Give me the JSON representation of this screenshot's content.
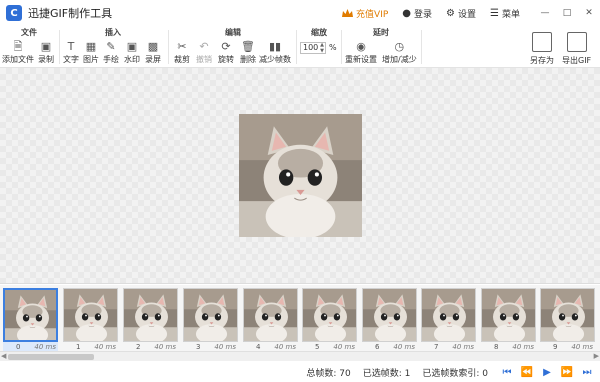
{
  "titlebar": {
    "app_title": "迅捷GIF制作工具",
    "vip_label": "充值VIP",
    "login_label": "登录",
    "settings_label": "设置",
    "menu_label": "菜单"
  },
  "ribbon": {
    "file": {
      "title": "文件",
      "add_file": "添加文件",
      "record": "录制"
    },
    "insert": {
      "title": "插入",
      "text": "文字",
      "image": "图片",
      "draw": "手绘",
      "watermark": "水印",
      "screen_record": "录屏"
    },
    "edit": {
      "title": "编辑",
      "crop": "裁剪",
      "undo": "撤销",
      "rotate": "旋转",
      "delete": "删除",
      "reduce_frames": "减少帧数"
    },
    "zoom": {
      "title": "缩放",
      "value": "100",
      "unit": "%"
    },
    "delay": {
      "title": "延时",
      "reset": "重新设置",
      "increase_decrease": "增加/减少"
    },
    "save_as": "另存为",
    "export_gif": "导出GIF"
  },
  "filmstrip": {
    "frames": [
      {
        "index": "0",
        "duration": "40 ms"
      },
      {
        "index": "1",
        "duration": "40 ms"
      },
      {
        "index": "2",
        "duration": "40 ms"
      },
      {
        "index": "3",
        "duration": "40 ms"
      },
      {
        "index": "4",
        "duration": "40 ms"
      },
      {
        "index": "5",
        "duration": "40 ms"
      },
      {
        "index": "6",
        "duration": "40 ms"
      },
      {
        "index": "7",
        "duration": "40 ms"
      },
      {
        "index": "8",
        "duration": "40 ms"
      },
      {
        "index": "9",
        "duration": "40 ms"
      }
    ],
    "selected_index": 0
  },
  "status": {
    "total_frames": "总帧数: 70",
    "selected_frames": "已选帧数: 1",
    "selected_index": "已选帧数索引: 0"
  },
  "colors": {
    "accent": "#2f6fd6",
    "vip": "#e07b00",
    "selected_frame_border": "#3c7fe0"
  }
}
